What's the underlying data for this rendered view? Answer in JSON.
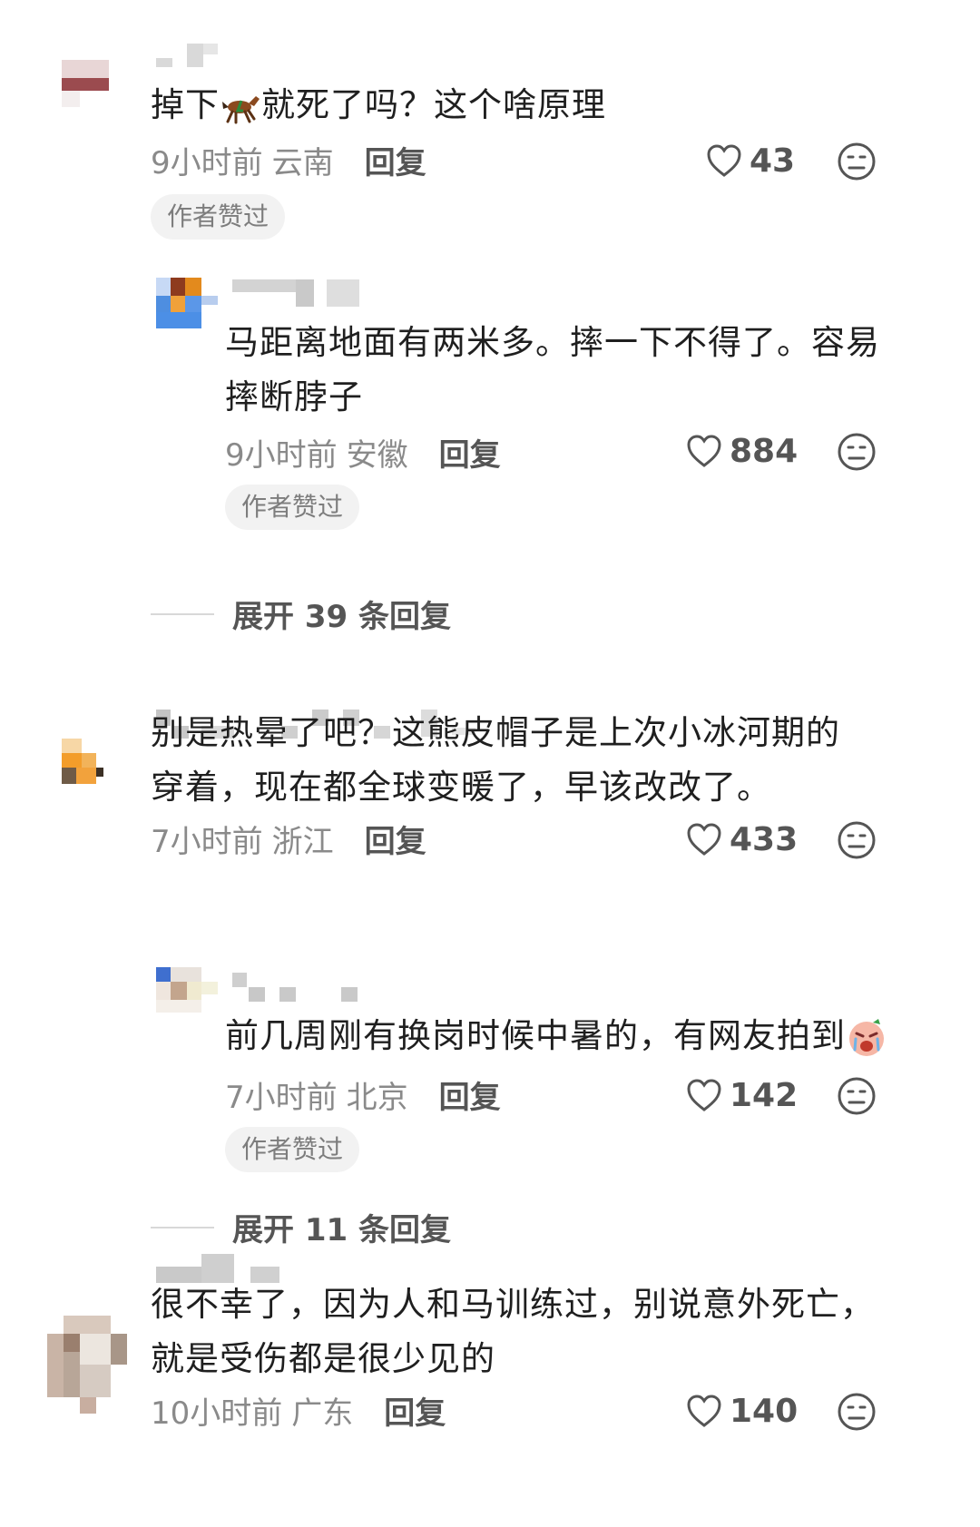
{
  "comments": [
    {
      "text_before": "掉下",
      "emoji": "horse-emoji",
      "text_after": "就死了吗？这个啥原理",
      "time": "9小时前",
      "location": "云南",
      "reply_label": "回复",
      "likes": "43",
      "badge": "作者赞过",
      "reply": {
        "text": "马距离地面有两米多。摔一下不得了。容易摔断脖子",
        "time": "9小时前",
        "location": "安徽",
        "reply_label": "回复",
        "likes": "884",
        "badge": "作者赞过"
      },
      "expand_label": "展开 39 条回复"
    },
    {
      "text": "别是热晕了吧？这熊皮帽子是上次小冰河期的穿着，现在都全球变暖了，早该改改了。",
      "time": "7小时前",
      "location": "浙江",
      "reply_label": "回复",
      "likes": "433",
      "reply": {
        "text": "前几周刚有换岗时候中暑的，有网友拍到",
        "emoji": "crying-face-emoji",
        "time": "7小时前",
        "location": "北京",
        "reply_label": "回复",
        "likes": "142",
        "badge": "作者赞过"
      },
      "expand_label": "展开 11 条回复"
    },
    {
      "text": "很不幸了，因为人和马训练过，别说意外死亡，就是受伤都是很少见的",
      "time": "10小时前",
      "location": "广东",
      "reply_label": "回复",
      "likes": "140"
    }
  ],
  "icons": {
    "like": "heart-outline-icon",
    "dislike": "unhappy-face-icon"
  }
}
